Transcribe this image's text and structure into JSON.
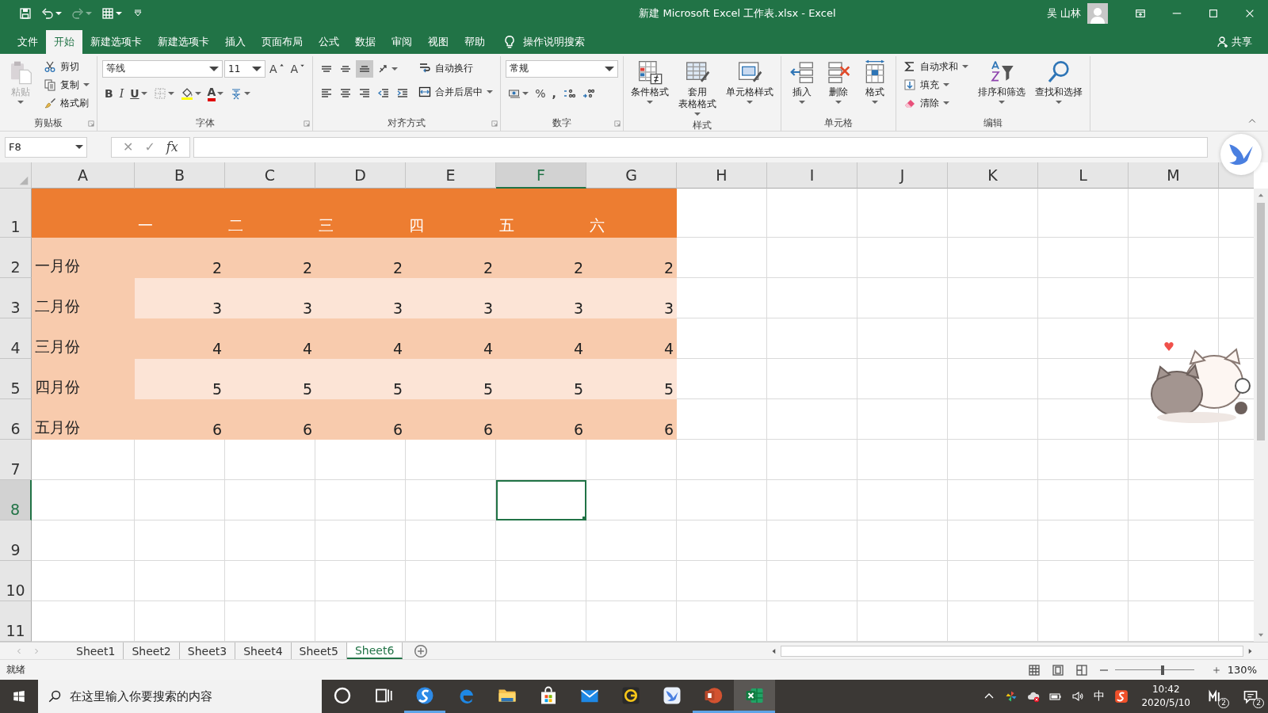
{
  "title_bar": {
    "quick_access": [
      {
        "disabled": false
      },
      {
        "disabled": false
      },
      {
        "disabled": true
      },
      {
        "disabled": false
      },
      {
        "disabled": false
      }
    ],
    "title": "新建 Microsoft Excel 工作表.xlsx  -  Excel",
    "user": "吴 山林"
  },
  "menu_tabs": [
    {
      "label": "文件",
      "selected": false
    },
    {
      "label": "开始",
      "selected": true
    },
    {
      "label": "新建选项卡",
      "selected": false
    },
    {
      "label": "新建选项卡",
      "selected": false
    },
    {
      "label": "插入",
      "selected": false
    },
    {
      "label": "页面布局",
      "selected": false
    },
    {
      "label": "公式",
      "selected": false
    },
    {
      "label": "数据",
      "selected": false
    },
    {
      "label": "审阅",
      "selected": false
    },
    {
      "label": "视图",
      "selected": false
    },
    {
      "label": "帮助",
      "selected": false
    }
  ],
  "tell_me": "操作说明搜索",
  "share": "共享",
  "ribbon": {
    "clipboard": {
      "label": "剪贴板",
      "paste": {
        "label": "粘贴",
        "disabled": true
      },
      "buttons": [
        "剪切",
        "复制",
        "格式刷"
      ]
    },
    "font": {
      "label": "字体",
      "font_name": "等线",
      "font_size": "11",
      "grow": "A",
      "shrink": "A",
      "bold": "B",
      "italic": "I",
      "underline": "U",
      "font_color": "A"
    },
    "alignment": {
      "label": "对齐方式",
      "vertical_align": [
        {
          "selected": false
        },
        {
          "selected": false
        },
        {
          "selected": true
        }
      ],
      "wrap": "自动换行",
      "merge": "合并后居中"
    },
    "number": {
      "label": "数字",
      "format": "常规",
      "percent": "%",
      "comma": ","
    },
    "styles": {
      "label": "样式",
      "buttons": [
        "条件格式",
        "套用表格格式",
        "单元格样式"
      ]
    },
    "cells": {
      "label": "单元格",
      "buttons": [
        "插入",
        "删除",
        "格式"
      ]
    },
    "editing": {
      "label": "编辑",
      "small": [
        "自动求和",
        "填充",
        "清除"
      ],
      "large": [
        "排序和筛选",
        "查找和选择"
      ]
    }
  },
  "formula_bar": {
    "name_box": "F8",
    "buttons": [
      "✕",
      "✓",
      "fx"
    ]
  },
  "sheet": {
    "columns": [
      {
        "label": "A",
        "selected": false
      },
      {
        "label": "B",
        "selected": false
      },
      {
        "label": "C",
        "selected": false
      },
      {
        "label": "D",
        "selected": false
      },
      {
        "label": "E",
        "selected": false
      },
      {
        "label": "F",
        "selected": true
      },
      {
        "label": "G",
        "selected": false
      },
      {
        "label": "H",
        "selected": false
      },
      {
        "label": "I",
        "selected": false
      },
      {
        "label": "J",
        "selected": false
      },
      {
        "label": "K",
        "selected": false
      },
      {
        "label": "L",
        "selected": false
      },
      {
        "label": "M",
        "selected": false
      }
    ],
    "rows": [
      {
        "header": "1",
        "selected": false,
        "kind": "header",
        "values": [
          "一",
          "二",
          "三",
          "四",
          "五",
          "六"
        ]
      },
      {
        "header": "2",
        "selected": false,
        "kind": "band1",
        "label": "一月份",
        "values": [
          "2",
          "2",
          "2",
          "2",
          "2",
          "2"
        ]
      },
      {
        "header": "3",
        "selected": false,
        "kind": "band2",
        "label": "二月份",
        "values": [
          "3",
          "3",
          "3",
          "3",
          "3",
          "3"
        ]
      },
      {
        "header": "4",
        "selected": false,
        "kind": "band1",
        "label": "三月份",
        "values": [
          "4",
          "4",
          "4",
          "4",
          "4",
          "4"
        ]
      },
      {
        "header": "5",
        "selected": false,
        "kind": "band2",
        "label": "四月份",
        "values": [
          "5",
          "5",
          "5",
          "5",
          "5",
          "5"
        ]
      },
      {
        "header": "6",
        "selected": false,
        "kind": "band1",
        "label": "五月份",
        "values": [
          "6",
          "6",
          "6",
          "6",
          "6",
          "6"
        ]
      },
      {
        "header": "7",
        "selected": false,
        "kind": "plain"
      },
      {
        "header": "8",
        "selected": true,
        "kind": "plain"
      },
      {
        "header": "9",
        "selected": false,
        "kind": "plain"
      },
      {
        "header": "10",
        "selected": false,
        "kind": "plain"
      },
      {
        "header": "11",
        "selected": false,
        "kind": "plain"
      }
    ]
  },
  "sheet_tabs": [
    {
      "label": "Sheet1",
      "selected": false
    },
    {
      "label": "Sheet2",
      "selected": false
    },
    {
      "label": "Sheet3",
      "selected": false
    },
    {
      "label": "Sheet4",
      "selected": false
    },
    {
      "label": "Sheet5",
      "selected": false
    },
    {
      "label": "Sheet6",
      "selected": true
    }
  ],
  "status_bar": {
    "status": "就绪",
    "zoom": "130%",
    "level": 0.6
  },
  "taskbar": {
    "search_placeholder": "在这里输入你要搜索的内容",
    "apps": [
      {
        "open": false,
        "focused": false
      },
      {
        "open": false,
        "focused": false
      },
      {
        "open": true,
        "focused": false
      },
      {
        "open": false,
        "focused": false
      },
      {
        "open": false,
        "focused": false
      },
      {
        "open": false,
        "focused": false
      },
      {
        "open": false,
        "focused": false
      },
      {
        "open": false,
        "focused": false
      },
      {
        "open": false,
        "focused": false
      },
      {
        "open": true,
        "focused": false
      },
      {
        "open": true,
        "focused": true
      }
    ],
    "ime": "中",
    "time": "10:42",
    "date": "2020/5/10",
    "im_badge": "2",
    "notification_count": "2"
  }
}
